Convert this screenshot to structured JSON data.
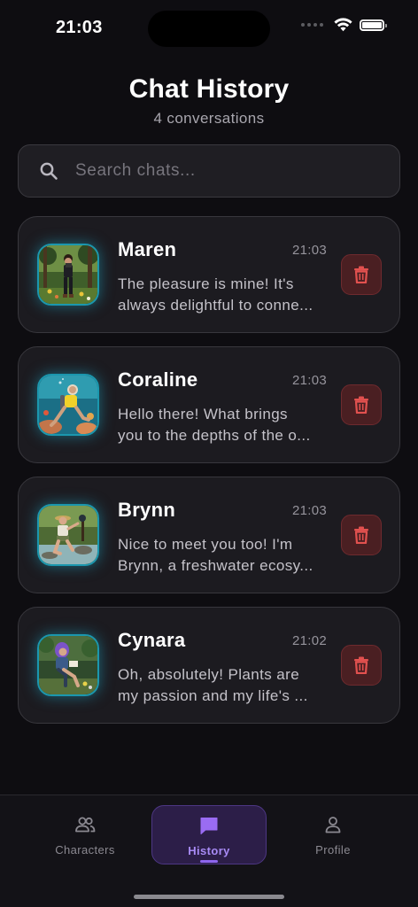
{
  "status_bar": {
    "time": "21:03"
  },
  "header": {
    "title": "Chat History",
    "subtitle": "4 conversations"
  },
  "search": {
    "placeholder": "Search chats..."
  },
  "chats": [
    {
      "name": "Maren",
      "time": "21:03",
      "preview_line1": "The pleasure is mine! It's",
      "preview_line2": "always delightful to conne...",
      "avatar_icon": "avatar-maren-forest-photographer"
    },
    {
      "name": "Coraline",
      "time": "21:03",
      "preview_line1": "Hello there! What brings",
      "preview_line2": "you to the depths of the o...",
      "avatar_icon": "avatar-coraline-diver"
    },
    {
      "name": "Brynn",
      "time": "21:03",
      "preview_line1": "Nice to meet you too! I'm",
      "preview_line2": "Brynn, a freshwater ecosy...",
      "avatar_icon": "avatar-brynn-stream-explorer"
    },
    {
      "name": "Cynara",
      "time": "21:02",
      "preview_line1": "Oh, absolutely! Plants are",
      "preview_line2": "my passion and my life's ...",
      "avatar_icon": "avatar-cynara-botanist"
    }
  ],
  "bottom_nav": {
    "tabs": [
      {
        "label": "Characters",
        "icon": "people-icon",
        "active": false
      },
      {
        "label": "History",
        "icon": "chat-bubble-icon",
        "active": true
      },
      {
        "label": "Profile",
        "icon": "person-icon",
        "active": false
      }
    ]
  },
  "colors": {
    "background": "#0e0d11",
    "card": "#1c1b20",
    "avatar_glow": "#1b97ae",
    "delete_bg": "#4a1f22",
    "delete_icon": "#e2514f",
    "accent": "#8e66ef"
  }
}
